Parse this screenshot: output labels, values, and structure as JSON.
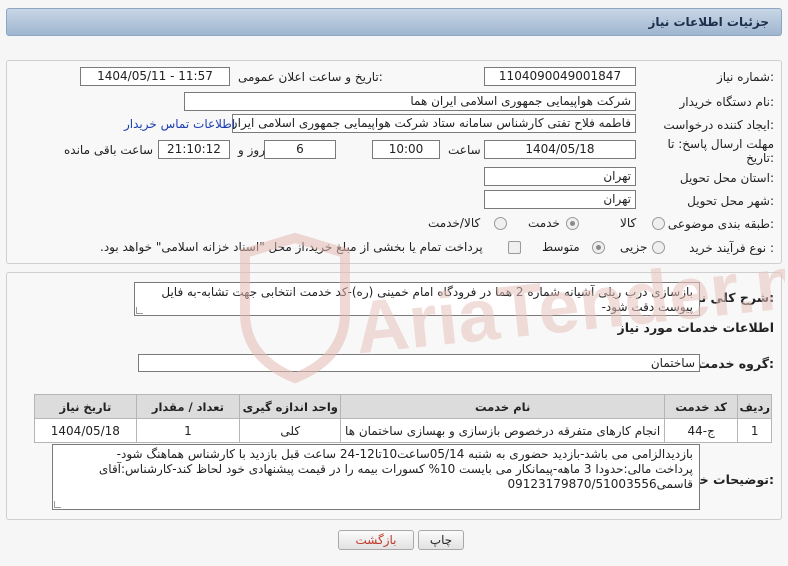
{
  "header": {
    "title": "جزئیات اطلاعات نیاز"
  },
  "form": {
    "need_number_label": "شماره نیاز:",
    "need_number": "1104090049001847",
    "announce_datetime_label": "تاریخ و ساعت اعلان عمومی:",
    "announce_datetime": "1404/05/11 - 11:57",
    "buyer_org_label": "نام دستگاه خریدار:",
    "buyer_org": "شرکت هواپیمایی جمهوری اسلامی ایران هما",
    "requester_label": "ایجاد کننده درخواست:",
    "requester": "فاطمه فلاح تفتی کارشناس سامانه ستاد شرکت هواپیمایی جمهوری اسلامی ایران هما",
    "buyer_contact_link": "اطلاعات تماس خریدار",
    "deadline_label_line1": "مهلت ارسال پاسخ: تا",
    "deadline_label_line2": "تاریخ:",
    "deadline_date": "1404/05/18",
    "time_label": "ساعت",
    "deadline_time": "10:00",
    "days_value": "6",
    "days_label": "روز و",
    "remaining_time": "21:10:12",
    "remaining_label": "ساعت باقی مانده",
    "province_label": "استان محل تحویل:",
    "province": "تهران",
    "city_label": "شهر محل تحویل:",
    "city": "تهران",
    "category_label": "طبقه بندی موضوعی:",
    "category_options": [
      "کالا",
      "خدمت",
      "کالا/خدمت"
    ],
    "category_selected": "خدمت",
    "process_label": "نوع فرآیند خرید :",
    "process_options": [
      "جزیی",
      "متوسط"
    ],
    "process_selected": "متوسط",
    "treasury_note": "پرداخت تمام یا بخشی از مبلغ خرید،از محل \"اسناد خزانه اسلامی\" خواهد بود."
  },
  "summary": {
    "label": "شرح کلی نیاز:",
    "text": "بازسازی درب ریلی آشیانه شماره 2 هما در فرودگاه امام خمینی (ره)-کد خدمت انتخابی جهت تشابه-به فایل پیوست دقت شود-"
  },
  "services": {
    "section_title": "اطلاعات خدمات مورد نیاز",
    "group_label": "گروه خدمت:",
    "group_value": "ساختمان",
    "columns": [
      "ردیف",
      "کد خدمت",
      "نام خدمت",
      "واحد اندازه گیری",
      "تعداد / مقدار",
      "تاریخ نیاز"
    ],
    "rows": [
      {
        "row": "1",
        "code": "ج-44",
        "name": "انجام کارهای متفرقه درخصوص بازسازی و بهسازی ساختمان ها",
        "unit": "کلی",
        "qty": "1",
        "date": "1404/05/18"
      }
    ]
  },
  "buyer_notes": {
    "label": "توضیحات خریدار:",
    "line1": "بازدیدالزامی می باشد-بازدید حضوری به شنبه 05/14ساعت10تا12-24 ساعت قبل بازدید با کارشناس هماهنگ شود-",
    "line2": "پرداخت مالی:حدودا 3 ماهه-پیمانکار می بایست 10% کسورات بیمه را در قیمت پیشنهادی خود لحاظ کند-کارشناس:آقای",
    "line3": "قاسمی09123179870/51003556"
  },
  "buttons": {
    "print": "چاپ",
    "back": "بازگشت"
  },
  "watermark": {
    "text": "AriaTender.neT"
  },
  "colors": {
    "header_bg": "#aabfd8",
    "link": "#1a3fb0",
    "back_text": "#c0392b",
    "watermark": "#e8c7c2"
  }
}
